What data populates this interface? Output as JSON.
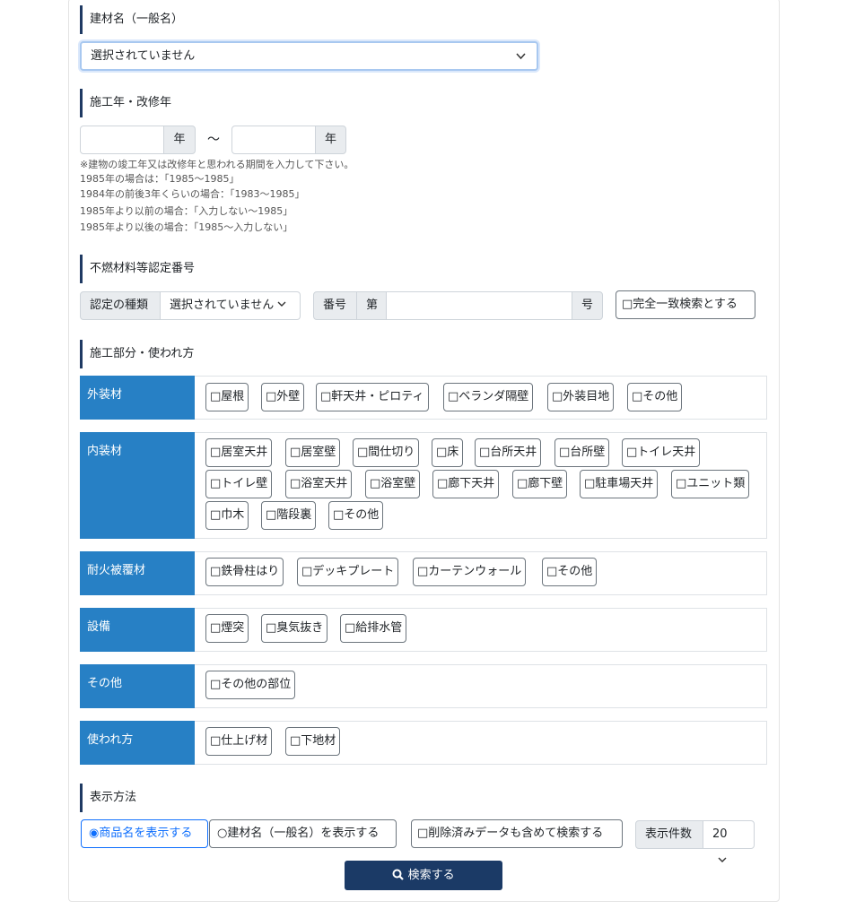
{
  "material_name": {
    "title": "建材名（一般名）",
    "select_value": "選択されていません"
  },
  "construction_year": {
    "title": "施工年・改修年",
    "from_value": "",
    "to_value": "",
    "year_unit": "年",
    "separator": "〜",
    "notes": [
      "※建物の竣工年又は改修年と思われる期間を入力して下さい。",
      "1985年の場合は：「1985〜1985」",
      "1984年の前後3年くらいの場合：「1983〜1985」",
      "1985年より以前の場合：「入力しない〜1985」",
      "1985年より以後の場合：「1985〜入力しない」"
    ]
  },
  "certification": {
    "title": "不燃材料等認定番号",
    "type_label": "認定の種類",
    "type_value": "選択されていません",
    "number_label": "番号",
    "prefix": "第",
    "number_value": "",
    "suffix": "号",
    "exact_match": "□完全一致検索とする"
  },
  "parts": {
    "title": "施工部分・使われ方",
    "rows": [
      {
        "label": "外装材",
        "options": [
          "□屋根",
          "□外壁",
          "□軒天井・ピロティ",
          "□ベランダ隔壁",
          "□外装目地",
          "□その他"
        ]
      },
      {
        "label": "内装材",
        "options": [
          "□居室天井",
          "□居室壁",
          "□間仕切り",
          "□床",
          "□台所天井",
          "□台所壁",
          "□トイレ天井",
          "□トイレ壁",
          "□浴室天井",
          "□浴室壁",
          "□廊下天井",
          "□廊下壁",
          "□駐車場天井",
          "□ユニット類",
          "□巾木",
          "□階段裏",
          "□その他"
        ]
      },
      {
        "label": "耐火被覆材",
        "options": [
          "□鉄骨柱はり",
          "□デッキプレート",
          "□カーテンウォール",
          "□その他"
        ]
      },
      {
        "label": "設備",
        "options": [
          "□煙突",
          "□臭気抜き",
          "□給排水管"
        ]
      },
      {
        "label": "その他",
        "options": [
          "□その他の部位"
        ]
      },
      {
        "label": "使われ方",
        "options": [
          "□仕上げ材",
          "□下地材"
        ]
      }
    ]
  },
  "display": {
    "title": "表示方法",
    "radio_product": "◉商品名を表示する",
    "radio_material": "○建材名（一般名）を表示する",
    "include_deleted": "□削除済みデータも含めて検索する",
    "count_label": "表示件数",
    "count_value": "20"
  },
  "search_button": "検索する"
}
